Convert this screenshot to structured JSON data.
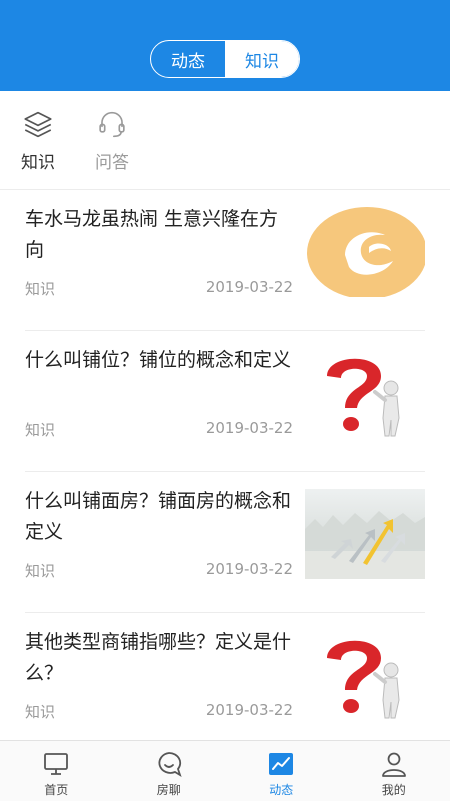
{
  "header": {
    "tabs": [
      {
        "label": "动态",
        "active": false
      },
      {
        "label": "知识",
        "active": true
      }
    ]
  },
  "subnav": {
    "items": [
      {
        "label": "知识",
        "icon": "layers-icon",
        "active": true
      },
      {
        "label": "问答",
        "icon": "headset-icon",
        "active": false
      }
    ]
  },
  "articles": [
    {
      "title": "车水马龙虽热闹 生意兴隆在方向",
      "tag": "知识",
      "date": "2019-03-22",
      "thumb": "orange-logo-thumbnail"
    },
    {
      "title": "什么叫铺位？铺位的概念和定义",
      "tag": "知识",
      "date": "2019-03-22",
      "thumb": "question-mark-figure-thumbnail"
    },
    {
      "title": "什么叫铺面房？铺面房的概念和定义",
      "tag": "知识",
      "date": "2019-03-22",
      "thumb": "rising-arrows-thumbnail"
    },
    {
      "title": "其他类型商铺指哪些？定义是什么？",
      "tag": "知识",
      "date": "2019-03-22",
      "thumb": "question-mark-figure-thumbnail"
    }
  ],
  "tabbar": {
    "items": [
      {
        "label": "首页",
        "icon": "monitor-icon",
        "active": false
      },
      {
        "label": "房聊",
        "icon": "chat-bubble-icon",
        "active": false
      },
      {
        "label": "动态",
        "icon": "trend-chart-icon",
        "active": true
      },
      {
        "label": "我的",
        "icon": "user-icon",
        "active": false
      }
    ]
  },
  "colors": {
    "accent": "#1d87e4",
    "text": "#222222",
    "muted": "#9a9a9a"
  }
}
